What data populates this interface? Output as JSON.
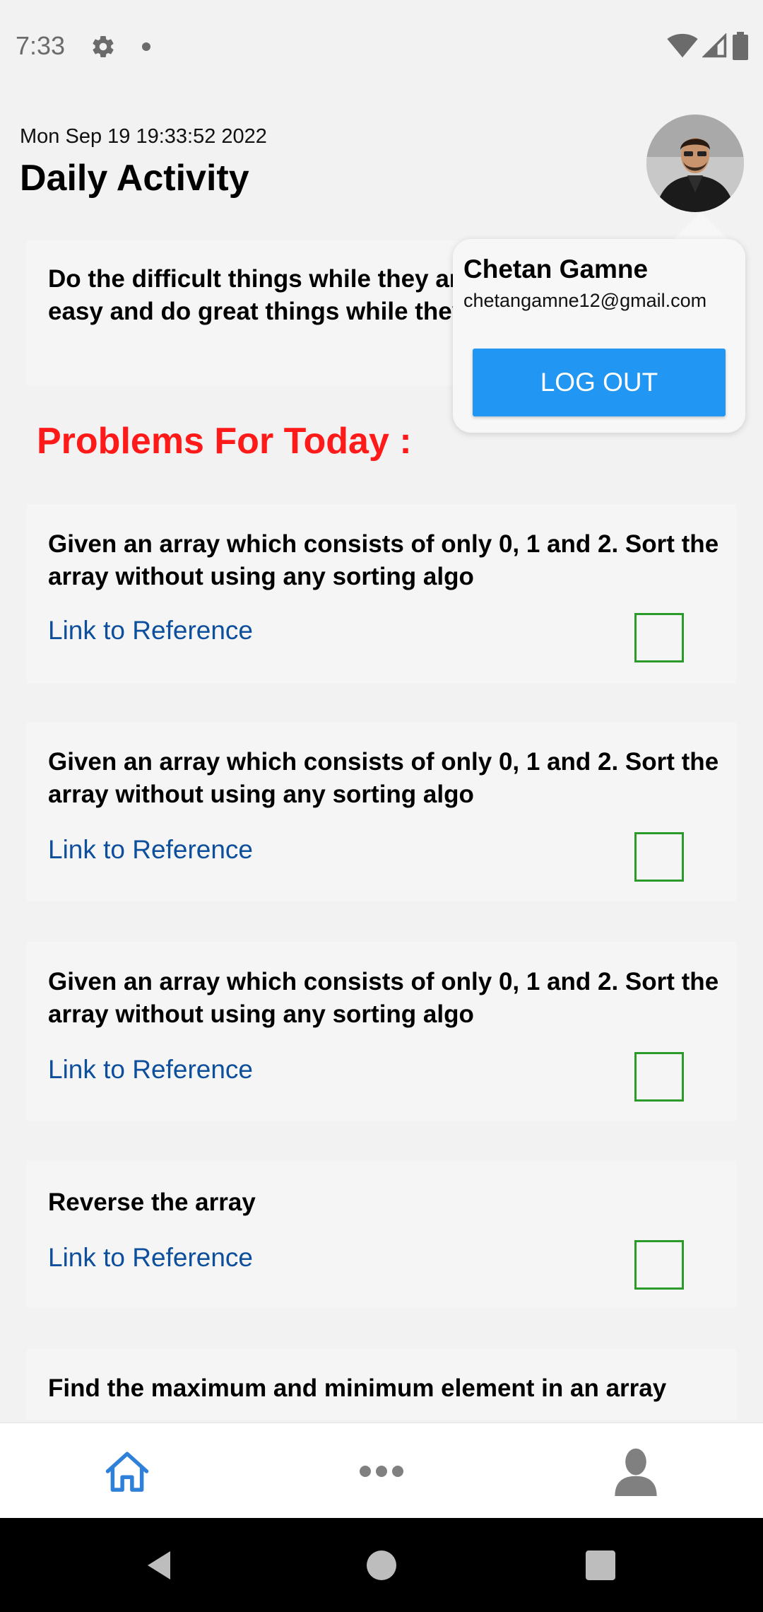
{
  "status_bar": {
    "time": "7:33",
    "icons": [
      "gear-icon",
      "notification-dot",
      "wifi-icon",
      "cell-signal-icon",
      "battery-icon"
    ]
  },
  "header": {
    "date": "Mon Sep 19 19:33:52 2022",
    "title": "Daily Activity"
  },
  "quote": {
    "text": "Do the difficult things while they are easy and do great things while they are small."
  },
  "section_title": "Problems For Today :",
  "problems": [
    {
      "text": "Given an array which consists of only 0, 1 and 2. Sort the array without using any sorting algo",
      "link": "Link to Reference",
      "checked": false
    },
    {
      "text": "Given an array which consists of only 0, 1 and 2. Sort the array without using any sorting algo",
      "link": "Link to Reference",
      "checked": false
    },
    {
      "text": "Given an array which consists of only 0, 1 and 2. Sort the array without using any sorting algo",
      "link": "Link to Reference",
      "checked": false
    },
    {
      "text": "Reverse the array",
      "link": "Link to Reference",
      "checked": false
    },
    {
      "text": "Find the maximum and minimum element in an array"
    }
  ],
  "profile_popup": {
    "name": "Chetan Gamne",
    "email": "chetangamne12@gmail.com",
    "logout_label": "LOG OUT"
  },
  "tab_bar": {
    "items": [
      {
        "icon": "home-icon",
        "active": true
      },
      {
        "icon": "more-icon",
        "active": false
      },
      {
        "icon": "user-icon",
        "active": false
      }
    ]
  },
  "colors": {
    "accent": "#2196f3",
    "section_title": "#ff1a1a",
    "link": "#0d4f9c",
    "checkbox": "#2a9a2a"
  }
}
